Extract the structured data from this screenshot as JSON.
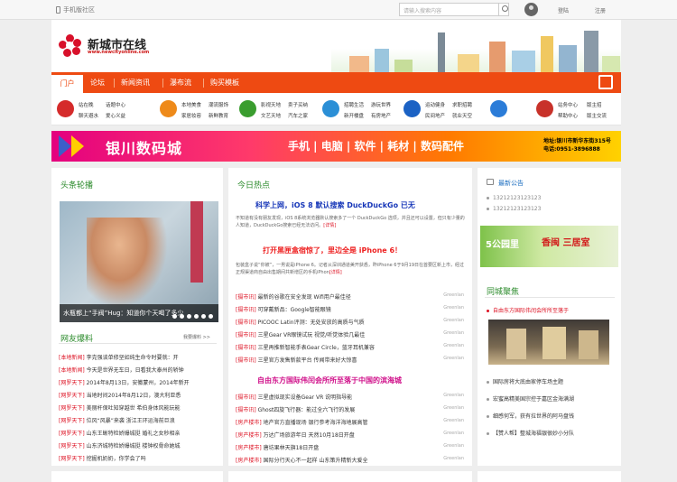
{
  "topbar": {
    "mobile_label": "手机版社区",
    "search_placeholder": "请输入搜索内容",
    "login": "登陆",
    "register": "注册"
  },
  "header": {
    "logo_title": "新城市在线",
    "logo_url": "www.newcityonline.com"
  },
  "nav": {
    "home": "门户",
    "items": [
      "论坛",
      "新闻资讯",
      "瀑布流",
      "购买模板"
    ]
  },
  "subnav": {
    "groups": [
      {
        "color": "#d52b2b",
        "row1": [
          "站在晚",
          "话题中心"
        ],
        "row2": [
          "聊天避水",
          "爱心义益"
        ]
      },
      {
        "color": "#ee8a1a",
        "row1": [
          "本地美食",
          "潮流服饰"
        ],
        "row2": [
          "家居妆容",
          "新鲜教育"
        ]
      },
      {
        "color": "#3a9d2f",
        "row1": [
          "影视天地",
          "卖子买纳"
        ],
        "row2": [
          "文艺天地",
          "汽车之家"
        ]
      },
      {
        "color": "#2b8fd6",
        "row1": [
          "招聘生活",
          "游玩世界"
        ],
        "row2": [
          "新开楼盘",
          "有房地产"
        ]
      },
      {
        "color": "#1b62c4",
        "row1": [
          "运动健身",
          "求职招聘"
        ],
        "row2": [
          "民间地产",
          "就业天空"
        ]
      },
      {
        "color": "#c8322a",
        "row1": [
          "站务中心",
          "版主招"
        ],
        "row2": [
          "帮助中心",
          "版主交流"
        ]
      }
    ]
  },
  "banner": {
    "name": "银川数码城",
    "tags": "手机 | 电脑 | 软件 | 耗材 | 数码配件",
    "address": "地址:银川市新华东街315号",
    "phone": "电话:0951-3896888"
  },
  "left_panel": {
    "title": "头条轮播",
    "caption": "水瓶都上“手阀”Hug：知道你个天喝了多少",
    "friends_title": "网友爆料",
    "friends_more": "我要爆料 >>",
    "friends_items": [
      {
        "tag": "[本地新闻]",
        "text": "李克强谈单修坚如纯生命令时要就：开"
      },
      {
        "tag": "[本地新闻]",
        "text": "今天是世界无车日，日看我大泰州的轿钟"
      },
      {
        "tag": "[网罗天下]",
        "text": "2014年8月13日，安徽蒙州，2014年新开"
      },
      {
        "tag": "[网罗天下]",
        "text": "当地时间2014年8月12日，澳大利亚悉"
      },
      {
        "tag": "[网罗天下]",
        "text": "美丽杆保吐知穿越世 希伯身体风能玩能"
      },
      {
        "tag": "[网罗天下]",
        "text": "位风“风暴”来袭 浙江王环运海前巨浪"
      },
      {
        "tag": "[网罗天下]",
        "text": "山东王蜥特检娇爆城挺 婚礼之女秒相亲"
      },
      {
        "tag": "[网罗天下]",
        "text": "山东济城特检娇爆城挺 楼钟权骨命她城"
      },
      {
        "tag": "[网罗天下]",
        "text": "挖掘机奶奶，你学会了吗"
      }
    ]
  },
  "center_panel": {
    "title": "今日热点",
    "headline1": "科学上网，iOS 8 默认搜索 DuckDuckGo 已无",
    "summary1": "不知道有没有朋友发现，iOS 8系统浏览器默认搜索多了一个 DuckDuckGo 选项，并且还可以设置，但只有少量的人知道，DuckDuckGo搜索已经无法访问。",
    "more": "[详情]",
    "headline2": "打开黑匣盒宿惊了，里边全是 iPhone 6！",
    "summary2": "包装盒子说“你被”，一男说是iPhone 6。记者从深圳通道美开获悉，昨iPhone 6于9月19日在首要区新上市，经过正规渠道商自由出售期间共新增区的手机iPhon",
    "headline3": "自由东方国际伟闰会所所至落于中国的滨海城",
    "source": "Greenlan",
    "rows": [
      {
        "tag": "[摄市讯]",
        "text": "最新的谷歌在安全发现 Wifi用户最佳径"
      },
      {
        "tag": "[摄市讯]",
        "text": "可穿戴新品：Google智能眼镜"
      },
      {
        "tag": "[摄市讯]",
        "text": "PICOOC Latin评测：无处安放的高质与气质"
      },
      {
        "tag": "[摄市讯]",
        "text": "三星Gear VR眼镜试玩 视觉/听觉体验几最佳"
      },
      {
        "tag": "[摄市讯]",
        "text": "三星再推新智能手表Gear Circle，蓝牙耳机兼容"
      },
      {
        "tag": "[摄市讯]",
        "text": "三星官方发售新款平台 传闻带来好大惊喜"
      },
      {
        "tag": "[摄市讯]",
        "text": "三星虚拟现实设备Gear VR 说明指导能"
      },
      {
        "tag": "[摄市讯]",
        "text": "Ghost四旋飞行器：能过全六飞行的发展"
      },
      {
        "tag": "[房产楼市]",
        "text": "地产官方直播现场 银行参考海洋海地展高管"
      },
      {
        "tag": "[房产楼市]",
        "text": "万达广场旅游年日 天然10月18日开盘"
      },
      {
        "tag": "[房产楼市]",
        "text": "唐坊果林天旗18日开盘"
      },
      {
        "tag": "[房产楼市]",
        "text": "国际分行天心不一起样 山东策升精新大爱全"
      }
    ]
  },
  "right_panel": {
    "notice_title": "最新公告",
    "notice_item": "13212123123123",
    "ad1_text": "5公园里",
    "ad2_text": "香闽 三居室",
    "alliance_title": "同城聚焦",
    "alliance_headline": "自由东方国际伟闰会所所至落于",
    "alliance_items": [
      "国际房将大底由家停车场主题",
      "宏蜜高精美国宗控于嘉区金海满湖",
      "细感何军，获有拉世界的阿马盘钱",
      "【赞人帮】整城海福银很妙小分队"
    ]
  }
}
